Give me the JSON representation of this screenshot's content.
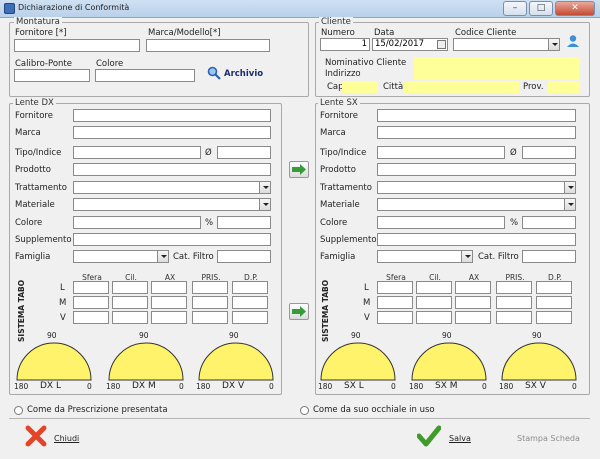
{
  "window": {
    "title": "Dichiarazione di Conformità",
    "controls": {
      "minimize": "–",
      "maximize": "□",
      "close": "✕"
    }
  },
  "montatura": {
    "legend": "Montatura",
    "fornitore_label": "Fornitore [*]",
    "marca_label": "Marca/Modello[*]",
    "calibro_label": "Calibro-Ponte",
    "colore_label": "Colore",
    "archivio_label": "Archivio"
  },
  "cliente": {
    "legend": "Cliente",
    "numero_label": "Numero",
    "numero_value": "1",
    "data_label": "Data",
    "data_value": "15/02/2017",
    "codice_label": "Codice Cliente",
    "nominativo_label": "Nominativo Cliente",
    "indirizzo_label": "Indirizzo",
    "cap_label": "Cap",
    "citta_label": "Città",
    "prov_label": "Prov."
  },
  "lente_dx": {
    "legend": "Lente DX",
    "fornitore": "Fornitore",
    "marca": "Marca",
    "tipo": "Tipo/Indice",
    "diam": "Ø",
    "prodotto": "Prodotto",
    "trattamento": "Trattamento",
    "materiale": "Materiale",
    "colore": "Colore",
    "perc": "%",
    "supplemento": "Supplemento",
    "famiglia": "Famiglia",
    "cat_filtro": "Cat. Filtro",
    "sistema_tabo": "SISTEMA TABO",
    "col_headers": [
      "Sfera",
      "Cil.",
      "AX",
      "PRIS.",
      "D.P."
    ],
    "row_labels": [
      "L",
      "M",
      "V"
    ],
    "gauges": [
      {
        "top": "90",
        "left": "180",
        "right": "0",
        "label": "DX L"
      },
      {
        "top": "90",
        "left": "180",
        "right": "0",
        "label": "DX M"
      },
      {
        "top": "90",
        "left": "180",
        "right": "0",
        "label": "DX V"
      }
    ]
  },
  "lente_sx": {
    "legend": "Lente SX",
    "fornitore": "Fornitore",
    "marca": "Marca",
    "tipo": "Tipo/Indice",
    "diam": "Ø",
    "prodotto": "Prodotto",
    "trattamento": "Trattamento",
    "materiale": "Materiale",
    "colore": "Colore",
    "perc": "%",
    "supplemento": "Supplemento",
    "famiglia": "Famiglia",
    "cat_filtro": "Cat. Filtro",
    "sistema_tabo": "SISTEMA TABO",
    "col_headers": [
      "Sfera",
      "Cil.",
      "AX",
      "PRIS.",
      "D.P."
    ],
    "row_labels": [
      "L",
      "M",
      "V"
    ],
    "gauges": [
      {
        "top": "90",
        "left": "180",
        "right": "0",
        "label": "SX L"
      },
      {
        "top": "90",
        "left": "180",
        "right": "0",
        "label": "SX M"
      },
      {
        "top": "90",
        "left": "180",
        "right": "0",
        "label": "SX V"
      }
    ]
  },
  "options": {
    "radio1": "Come da Prescrizione presentata",
    "radio2": "Come da suo occhiale in uso"
  },
  "footer": {
    "chiudi": "Chiudi",
    "salva": "Salva",
    "stampa": "Stampa Scheda"
  },
  "colors": {
    "yellow": "#ffff99",
    "gauge": "#fff36b",
    "title_bar": "#b9d1ea"
  }
}
